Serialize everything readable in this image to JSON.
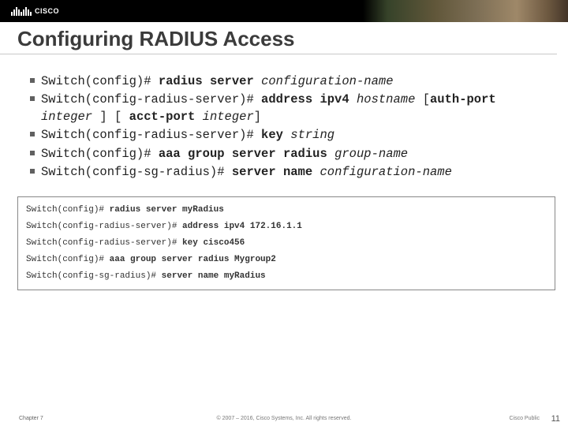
{
  "banner": {
    "logo_text": "CISCO"
  },
  "title": "Configuring RADIUS Access",
  "commands": [
    {
      "segments": [
        {
          "t": "Switch(config)# "
        },
        {
          "t": "radius server ",
          "b": true
        },
        {
          "t": "configuration-name",
          "i": true
        }
      ]
    },
    {
      "segments": [
        {
          "t": "Switch(config-radius-server)# "
        },
        {
          "t": "address ipv4 ",
          "b": true
        },
        {
          "t": "hostname ",
          "i": true
        },
        {
          "t": "[",
          "b": false
        },
        {
          "t": "auth-port ",
          "b": true
        },
        {
          "t": "integer ",
          "i": true
        },
        {
          "t": "] [ "
        },
        {
          "t": "acct-port ",
          "b": true
        },
        {
          "t": "integer",
          "i": true
        },
        {
          "t": "]"
        }
      ]
    },
    {
      "segments": [
        {
          "t": "Switch(config-radius-server)# "
        },
        {
          "t": "key ",
          "b": true
        },
        {
          "t": "string",
          "i": true
        }
      ]
    },
    {
      "segments": [
        {
          "t": "Switch(config)# "
        },
        {
          "t": "aaa group server radius ",
          "b": true
        },
        {
          "t": "group-name",
          "i": true
        }
      ]
    },
    {
      "segments": [
        {
          "t": "Switch(config-sg-radius)# "
        },
        {
          "t": "server name ",
          "b": true
        },
        {
          "t": "configuration-name",
          "i": true
        }
      ]
    }
  ],
  "example": [
    [
      {
        "t": "Switch(config)# "
      },
      {
        "t": "radius server myRadius",
        "b": true
      }
    ],
    [
      {
        "t": "Switch(config-radius-server)# "
      },
      {
        "t": "address ipv4 172.16.1.1",
        "b": true
      }
    ],
    [
      {
        "t": "Switch(config-radius-server)# "
      },
      {
        "t": "key cisco456",
        "b": true
      }
    ],
    [
      {
        "t": "Switch(config)# "
      },
      {
        "t": "aaa group server radius Mygroup2",
        "b": true
      }
    ],
    [
      {
        "t": "Switch(config-sg-radius)# "
      },
      {
        "t": "server name myRadius",
        "b": true
      }
    ]
  ],
  "footer": {
    "chapter": "Chapter 7",
    "copyright": "© 2007 – 2016, Cisco Systems, Inc. All rights reserved.",
    "public": "Cisco Public",
    "page": "11"
  }
}
